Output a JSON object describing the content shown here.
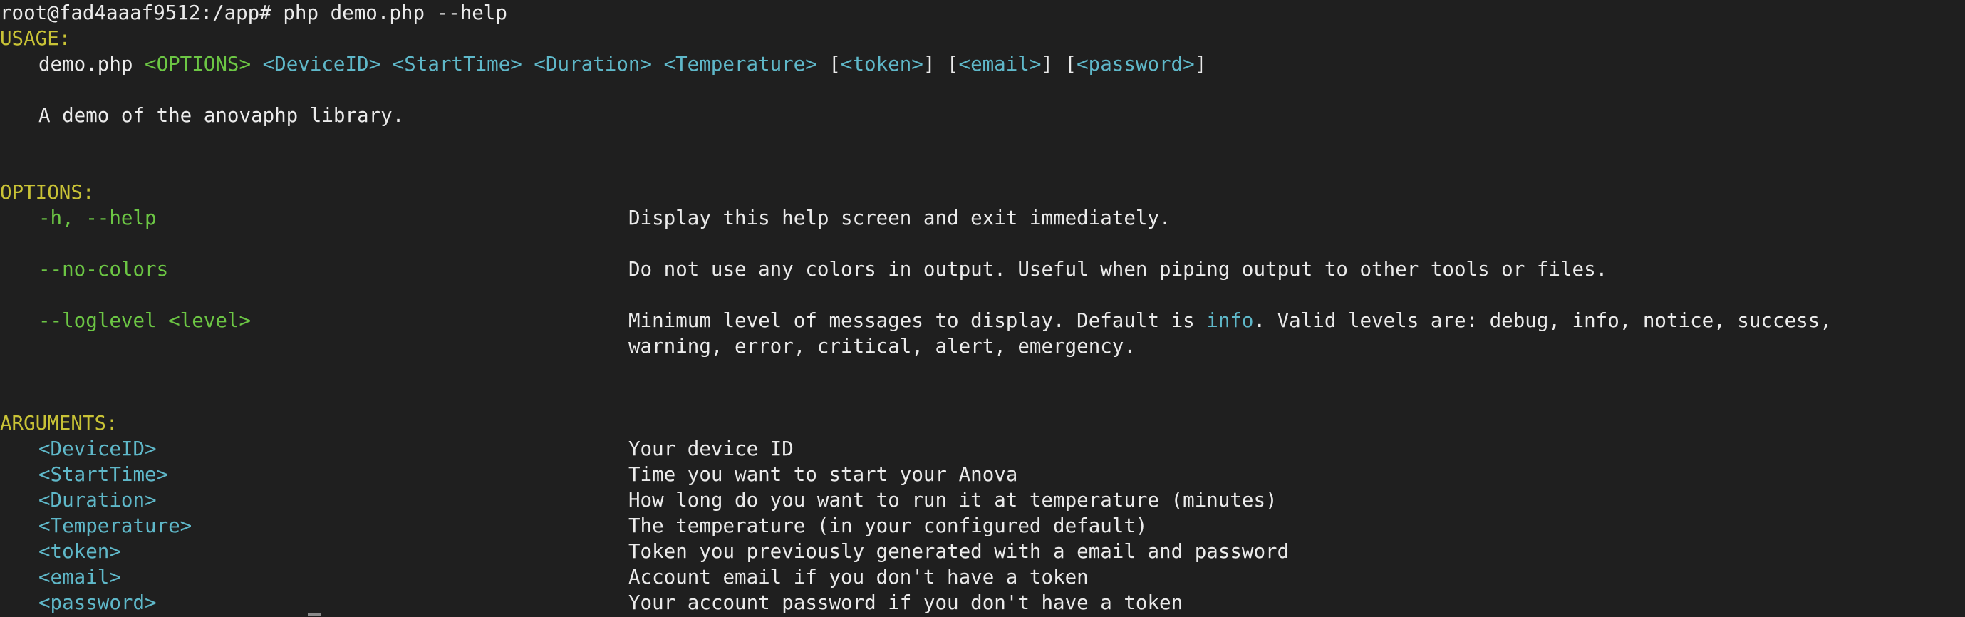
{
  "prompt": "root@fad4aaaf9512:/app# php demo.php --help",
  "usage": {
    "heading": "USAGE:",
    "script": "demo.php",
    "options_placeholder": "<OPTIONS>",
    "args": [
      "<DeviceID>",
      "<StartTime>",
      "<Duration>",
      "<Temperature>"
    ],
    "optional_args": [
      "<token>",
      "<email>",
      "<password>"
    ],
    "description": "A demo of the anovaphp library."
  },
  "options": {
    "heading": "OPTIONS:",
    "items": [
      {
        "flag": "-h, --help",
        "description": "Display this help screen and exit immediately."
      },
      {
        "flag": "--no-colors",
        "description": "Do not use any colors in output. Useful when piping output to other tools or files."
      },
      {
        "flag": "--loglevel <level>",
        "description_before": "Minimum level of messages to display. Default is ",
        "description_highlight": "info",
        "description_after": ". Valid levels are: debug, info, notice, success,",
        "description_line2": "warning, error, critical, alert, emergency."
      }
    ]
  },
  "arguments": {
    "heading": "ARGUMENTS:",
    "items": [
      {
        "name": "<DeviceID>",
        "description": "Your device ID"
      },
      {
        "name": "<StartTime>",
        "description": "Time you want to start your Anova"
      },
      {
        "name": "<Duration>",
        "description": "How long do you want to run it at temperature (minutes)"
      },
      {
        "name": "<Temperature>",
        "description": "The temperature (in your configured default)"
      },
      {
        "name": "<token>",
        "description": "Token you previously generated with a email and password"
      },
      {
        "name": "<email>",
        "description": "Account email if you don't have a token"
      },
      {
        "name": "<password>",
        "description": "Your account password if you don't have a token"
      }
    ]
  },
  "colors": {
    "background": "#1f1f1f",
    "text": "#ebebeb",
    "heading": "#c9c336",
    "option": "#6cc644",
    "argument": "#5fb8c9"
  }
}
